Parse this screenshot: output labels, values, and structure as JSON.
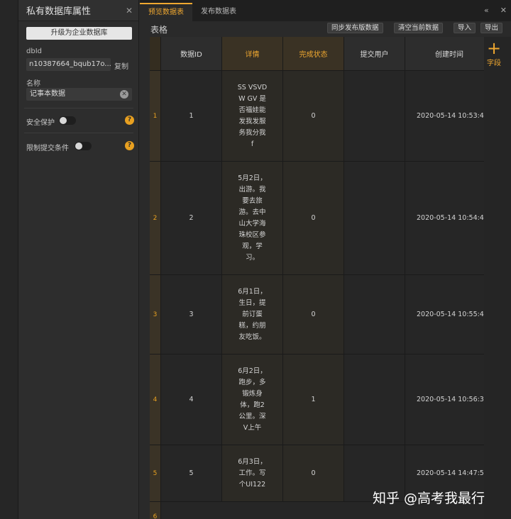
{
  "panel": {
    "title": "私有数据库属性",
    "upgrade_label": "升级为企业数据库",
    "dbid_label": "dbId",
    "dbid_value": "n10387664_bqub17o...",
    "copy_label": "复制",
    "name_label": "名称",
    "name_value": "记事本数据",
    "security_label": "安全保护",
    "limit_label": "限制提交条件",
    "help_glyph": "?",
    "clear_glyph": "✕",
    "close_glyph": "✕"
  },
  "tabs": {
    "preview": "预览数据表",
    "publish": "发布数据表",
    "collapse_glyph": "«",
    "close_glyph": "✕"
  },
  "toolbar": {
    "title": "表格",
    "sync_label": "同步发布版数据",
    "clear_label": "清空当前数据",
    "import_label": "导入",
    "export_label": "导出"
  },
  "grid": {
    "columns": [
      "数据ID",
      "详情",
      "完成状态",
      "提交用户",
      "创建时间"
    ],
    "rows": [
      {
        "num": "1",
        "id": "1",
        "detail": "SS VSVDW GV 是否福娃能发我发服务我分我 f",
        "status": "0",
        "user": "",
        "time": "2020-05-14 10:53:4"
      },
      {
        "num": "2",
        "id": "2",
        "detail": "5月2日，出游。我要去旅游。去中山大学海珠校区参观，学习。",
        "status": "0",
        "user": "",
        "time": "2020-05-14 10:54:4"
      },
      {
        "num": "3",
        "id": "3",
        "detail": "6月1日，生日，提前订蛋糕，约朋友吃饭。",
        "status": "0",
        "user": "",
        "time": "2020-05-14 10:55:4"
      },
      {
        "num": "4",
        "id": "4",
        "detail": "6月2日，跑步，多锻炼身体，跑2公里。深V上午",
        "status": "1",
        "user": "",
        "time": "2020-05-14 10:56:3"
      },
      {
        "num": "5",
        "id": "5",
        "detail": "6月3日，工作。写个UI122",
        "status": "0",
        "user": "",
        "time": "2020-05-14 14:47:5"
      }
    ],
    "next_row_num": "6"
  },
  "add_field": {
    "plus": "+",
    "label": "字段"
  },
  "watermark": "知乎 @高考我最行",
  "colors": {
    "accent": "#f0a830",
    "help": "#e8a020"
  }
}
